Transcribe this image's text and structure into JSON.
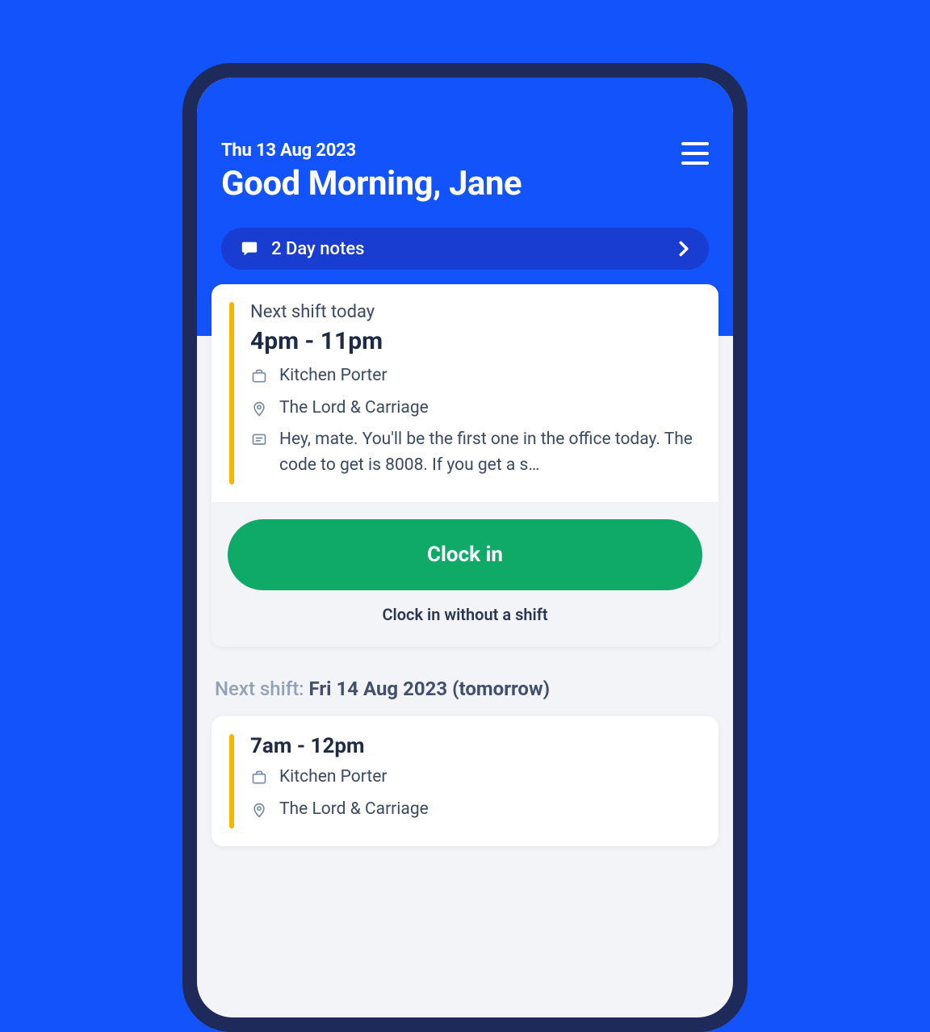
{
  "header": {
    "date": "Thu 13 Aug 2023",
    "greeting": "Good Morning, Jane"
  },
  "day_notes": {
    "label": "2 Day notes"
  },
  "shift_today": {
    "label": "Next shift today",
    "time": "4pm - 11pm",
    "role": "Kitchen Porter",
    "location": "The Lord & Carriage",
    "note": "Hey, mate. You'll be the first one in the office today. The code to get is 8008. If you get a s…"
  },
  "actions": {
    "clock_in": "Clock in",
    "clock_in_alt": "Clock in without a shift"
  },
  "next_shift": {
    "prefix": "Next shift: ",
    "value": "Fri 14 Aug 2023 (tomorrow)",
    "time": "7am - 12pm",
    "role": "Kitchen Porter",
    "location": "The Lord & Carriage"
  },
  "colors": {
    "brand": "#1353fc",
    "accent": "#f7b500",
    "success": "#0fa968"
  }
}
